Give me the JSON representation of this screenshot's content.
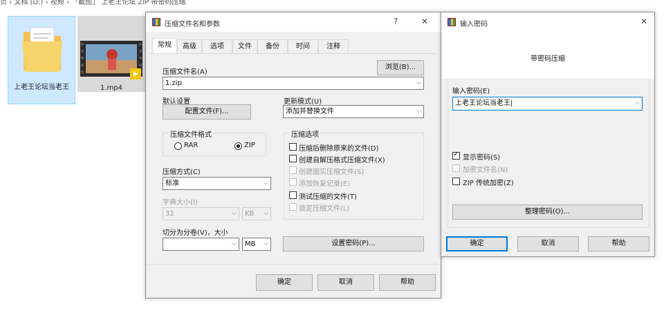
{
  "explorer": {
    "breadcrumb": "页 › 文档 (D:) › 视频 › 「截图」 上老王论坛 ZIP 带密码压缩",
    "files": [
      {
        "name": "上老王论坛当老王",
        "type": "folder-icon"
      },
      {
        "name": "1.mp4",
        "type": "video-icon"
      }
    ]
  },
  "archive_dialog": {
    "title": "压缩文件名和参数",
    "help_glyph": "?",
    "close_glyph": "✕",
    "tabs": [
      "常规",
      "高级",
      "选项",
      "文件",
      "备份",
      "时间",
      "注释"
    ],
    "active_tab": "常规",
    "archive_name_label": "压缩文件名(A)",
    "browse_button": "浏览(B)...",
    "archive_name_value": "1.zip",
    "default_settings_label": "默认设置",
    "profiles_button": "配置文件(F)...",
    "update_mode_label": "更新模式(U)",
    "update_mode_value": "添加并替换文件",
    "format_group_title": "压缩文件格式",
    "format_rar": "RAR",
    "format_zip": "ZIP",
    "format_selected": "ZIP",
    "options_group_title": "压缩选项",
    "options": [
      {
        "label": "压缩后删除原来的文件(D)",
        "checked": false,
        "enabled": true
      },
      {
        "label": "创建自解压格式压缩文件(X)",
        "checked": false,
        "enabled": true
      },
      {
        "label": "创建固实压缩文件(S)",
        "checked": false,
        "enabled": false
      },
      {
        "label": "添加恢复记录(E)",
        "checked": false,
        "enabled": false
      },
      {
        "label": "测试压缩的文件(T)",
        "checked": false,
        "enabled": true
      },
      {
        "label": "锁定压缩文件(L)",
        "checked": false,
        "enabled": false
      }
    ],
    "method_label": "压缩方式(C)",
    "method_value": "标准",
    "dict_label": "字典大小(I)",
    "dict_value": "32",
    "dict_unit": "KB",
    "split_label": "切分为分卷(V)，大小",
    "split_value": "",
    "split_unit": "MB",
    "set_password_button": "设置密码(P)...",
    "ok_button": "确定",
    "cancel_button": "取消",
    "help_button": "帮助"
  },
  "password_dialog": {
    "title": "输入密码",
    "close_glyph": "✕",
    "heading": "带密码压缩",
    "password_label": "输入密码(E)",
    "password_value": "上老王论坛当老王",
    "show_password": {
      "label": "显示密码(S)",
      "checked": true,
      "enabled": true
    },
    "encrypt_names": {
      "label": "加密文件名(N)",
      "checked": false,
      "enabled": false
    },
    "zip_legacy": {
      "label": "ZIP 传统加密(Z)",
      "checked": false,
      "enabled": true
    },
    "organize_button": "整理密码(O)...",
    "ok_button": "确定",
    "cancel_button": "取消",
    "help_button": "帮助"
  },
  "colors": {
    "selection": "#cde8ff",
    "accent": "#0078d7",
    "window_bg": "#f0f0f0"
  }
}
